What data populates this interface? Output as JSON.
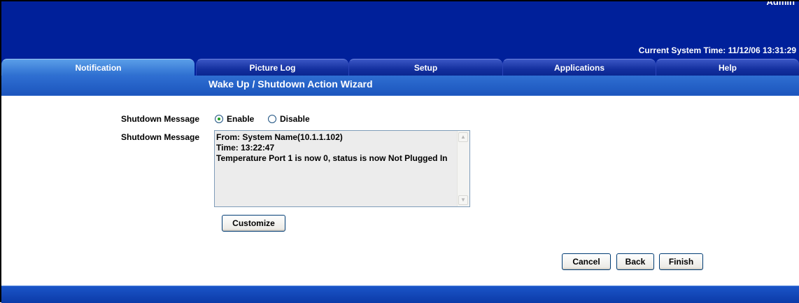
{
  "header": {
    "user_label": "Admin",
    "system_time": "Current System Time: 11/12/06 13:31:29",
    "background_color": "#00209a"
  },
  "tabs": [
    {
      "label": "Notification",
      "active": true
    },
    {
      "label": "Picture Log",
      "active": false
    },
    {
      "label": "Setup",
      "active": false
    },
    {
      "label": "Applications",
      "active": false
    },
    {
      "label": "Help",
      "active": false
    }
  ],
  "page_title": "Wake Up / Shutdown Action Wizard",
  "form": {
    "shutdown_message_label": "Shutdown Message",
    "radio_enable": "Enable",
    "radio_disable": "Disable",
    "selected": "Enable",
    "message_label": "Shutdown Message",
    "message_text": "From: System Name(10.1.1.102)\nTime: 13:22:47\nTemperature Port 1 is now 0, status is now Not Plugged In",
    "customize_button": "Customize"
  },
  "actions": {
    "cancel": "Cancel",
    "back": "Back",
    "finish": "Finish"
  },
  "icons": {
    "scroll_up": "scroll-up-arrow-icon",
    "scroll_down": "scroll-down-arrow-icon"
  }
}
